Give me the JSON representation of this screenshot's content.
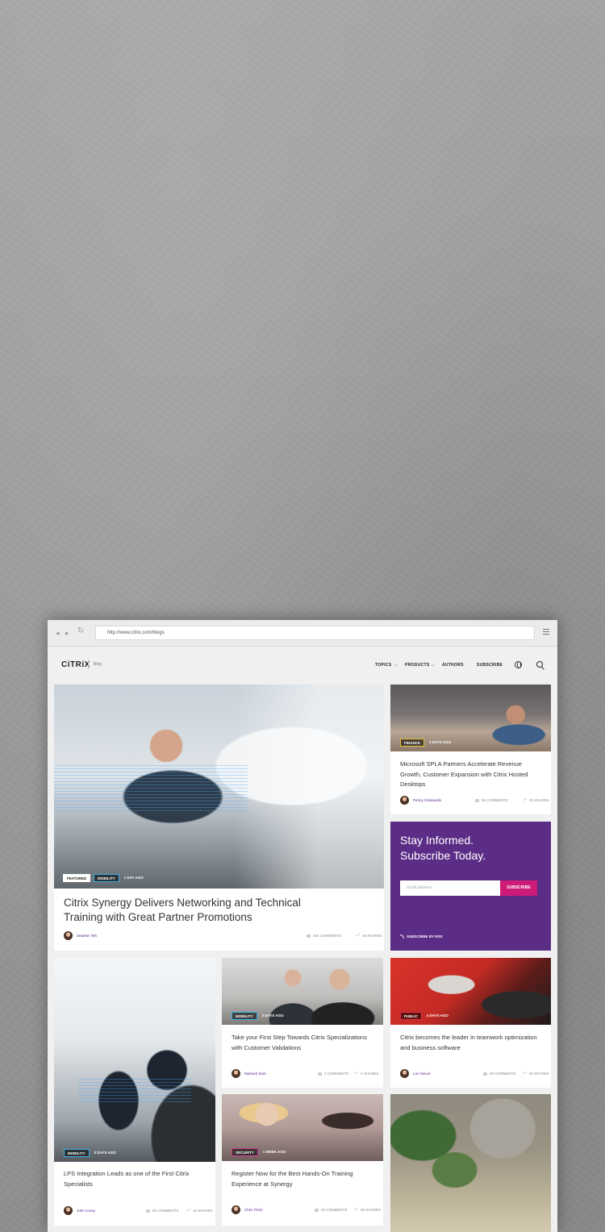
{
  "browser": {
    "url": "http://www.citrix.com/blogs"
  },
  "site": {
    "logo": "CiTRiX",
    "section": "Blog",
    "nav": [
      "TOPICS",
      "PRODUCTS",
      "AUTHORS",
      "SUBSCRIBE"
    ],
    "icons": [
      "globe-icon",
      "search-icon"
    ]
  },
  "featured": {
    "tags": [
      "FEATURED",
      "MOBILITY"
    ],
    "ago": "1 DAY AGO",
    "title": "Citrix Synergy Delivers Networking and Technical Training with Great Partner Promotions",
    "author": "Stephen Teh",
    "comments": "200 COMMENTS",
    "shares": "19 SHARES"
  },
  "side1": {
    "tag": "FINANCE",
    "ago": "2 DAYS AGO",
    "title": "Microsoft SPLA Partners Accelerate Revenue Growth, Customer Expansion with Citrix Hosted Desktops",
    "author": "Penny Grakowski",
    "comments": "55 COMMENTS",
    "shares": "20 SHARES"
  },
  "subscribe": {
    "title_line1": "Stay Informed.",
    "title_line2": "Subscribe Today.",
    "placeholder": "email address",
    "button": "SUBSCRIBE",
    "rss": "SUBSCRIBE BY RSS"
  },
  "posts": [
    {
      "tag": "MOBILITY",
      "ago": "3 DAYS AGO",
      "title": "LPS Integration Leads as one of the First Citrix Specialists",
      "author": "John Carey",
      "comments": "55 COMMENTS",
      "shares": "19 SHARES"
    },
    {
      "tag": "MOBILITY",
      "ago": "3 DAYS AGO",
      "title": "Take your First Step Towards Citrix Specializations with Customer Validations",
      "author": "Moheeb Zara",
      "comments": "4 COMMENTS",
      "shares": "4 SHARES"
    },
    {
      "tag": "PUBLIC",
      "ago": "4 DAYS AGO",
      "title": "Citrix becomes the leader in teamwork optimization and business software",
      "author": "Lori Seiure",
      "comments": "20 COMMENTS",
      "shares": "20 SHARES"
    },
    {
      "tag": "SECURITY",
      "ago": "1 WEEK AGO",
      "title": "Register Now for the Best Hands-On Training Experience at Synergy",
      "author": "Chris Fleck",
      "comments": "30 COMMENTS",
      "shares": "20 SHARES"
    }
  ],
  "colors": {
    "brand_purple": "#5c2d86",
    "subscribe_pink": "#cf1b78",
    "tag_blue": "#3ab0e8",
    "tag_yellow": "#e3c234",
    "tag_red": "#e0314b",
    "tag_pink": "#d43f9a"
  }
}
